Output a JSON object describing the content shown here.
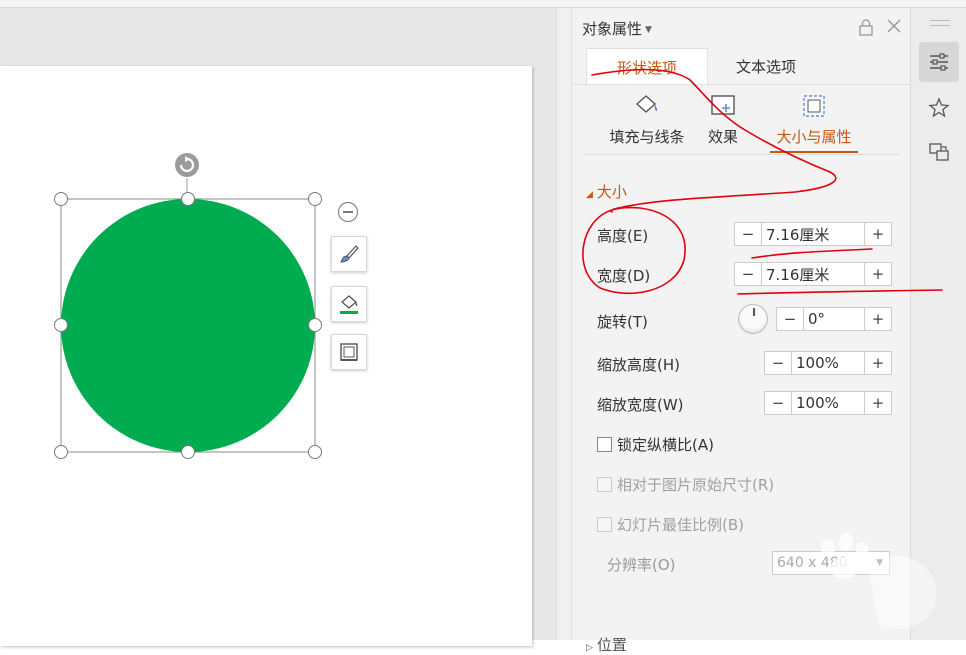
{
  "panel": {
    "title": "对象属性",
    "tabs": {
      "shape": "形状选项",
      "text": "文本选项"
    },
    "subtabs": {
      "fill_line": "填充与线条",
      "effect": "效果",
      "size_props": "大小与属性"
    },
    "section_size": "大小",
    "height": {
      "label": "高度(E)",
      "value": "7.16厘米"
    },
    "width": {
      "label": "宽度(D)",
      "value": "7.16厘米"
    },
    "rotation": {
      "label": "旋转(T)",
      "value": "0°"
    },
    "scale_height": {
      "label": "缩放高度(H)",
      "value": "100%"
    },
    "scale_width": {
      "label": "缩放宽度(W)",
      "value": "100%"
    },
    "lock_aspect": {
      "label": "锁定纵横比(A)",
      "checked": false
    },
    "relative_original": {
      "label": "相对于图片原始尺寸(R)",
      "checked": false,
      "enabled": false
    },
    "best_scale": {
      "label": "幻灯片最佳比例(B)",
      "checked": false,
      "enabled": false
    },
    "resolution": {
      "label": "分辨率(O)",
      "value": "640 x 480"
    },
    "section_position": "位置"
  },
  "spin_minus": "−",
  "spin_plus": "+",
  "colors": {
    "shape_fill": "#00ac4f",
    "accent": "#c7560f",
    "annotation": "#e1000f"
  },
  "icons": {
    "rotate_handle": "rotate-icon",
    "collapse": "minus-circle-icon",
    "style_brush": "brush-icon",
    "fill": "paint-bucket-icon",
    "outline": "frame-icon",
    "lock": "lock-icon",
    "close": "close-icon",
    "properties": "sliders-icon",
    "animation": "star-icon",
    "transition": "transition-icon"
  }
}
